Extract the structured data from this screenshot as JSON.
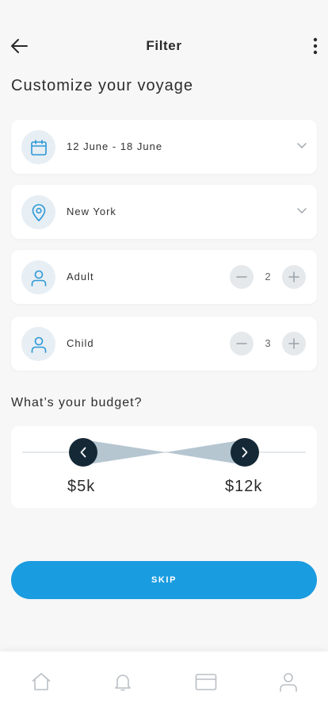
{
  "header": {
    "title": "Filter"
  },
  "heading": "Customize your voyage",
  "filters": {
    "dates": {
      "label": "12 June - 18 June"
    },
    "location": {
      "label": "New York"
    },
    "adult": {
      "label": "Adult",
      "value": "2"
    },
    "child": {
      "label": "Child",
      "value": "3"
    }
  },
  "budget": {
    "heading": "What’s your budget?",
    "min_label": "$5k",
    "max_label": "$12k"
  },
  "skip_label": "SKIP",
  "colors": {
    "accent": "#1a9ce0",
    "handle": "#152836",
    "icon_bg": "#e7eef4",
    "range_fill": "#b5c6d1"
  },
  "bottom_nav": {
    "items": [
      "home-icon",
      "bell-icon",
      "card-icon",
      "profile-icon"
    ]
  }
}
